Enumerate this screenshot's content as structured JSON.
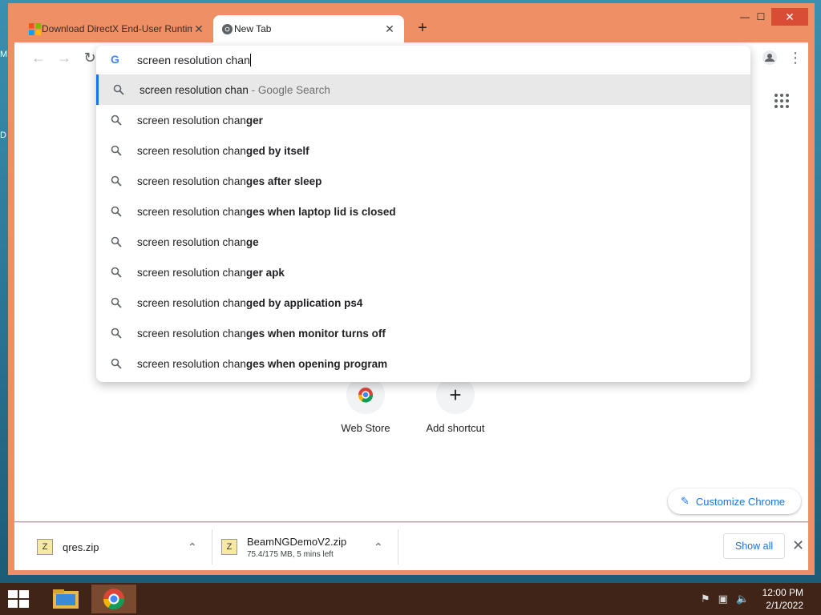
{
  "desktop": {
    "letters": [
      "M",
      "D"
    ]
  },
  "tabs": [
    {
      "title": "Download DirectX End-User Runtime",
      "close": "✕"
    },
    {
      "title": "New Tab",
      "close": "✕"
    }
  ],
  "new_tab_symbol": "+",
  "window_controls": {
    "minimize": "—",
    "maximize": "☐",
    "close": "✕"
  },
  "omnibox": {
    "input": "screen resolution chan",
    "google_glyph": "G",
    "suggestions": [
      {
        "typed": "screen resolution chan",
        "rest": "",
        "desc": " - Google Search",
        "selected": true
      },
      {
        "typed": "screen resolution chan",
        "rest": "ger"
      },
      {
        "typed": "screen resolution chan",
        "rest": "ged by itself"
      },
      {
        "typed": "screen resolution chan",
        "rest": "ges after sleep"
      },
      {
        "typed": "screen resolution chan",
        "rest": "ges when laptop lid is closed"
      },
      {
        "typed": "screen resolution chan",
        "rest": "ge"
      },
      {
        "typed": "screen resolution chan",
        "rest": "ger apk"
      },
      {
        "typed": "screen resolution chan",
        "rest": "ged by application ps4"
      },
      {
        "typed": "screen resolution chan",
        "rest": "ges when monitor turns off"
      },
      {
        "typed": "screen resolution chan",
        "rest": "ges when opening program"
      }
    ]
  },
  "shortcuts": [
    {
      "label": "Web Store"
    },
    {
      "label": "Add shortcut",
      "symbol": "+"
    }
  ],
  "customize_label": "Customize Chrome",
  "downloads": {
    "items": [
      {
        "name": "qres.zip",
        "status": ""
      },
      {
        "name": "BeamNGDemoV2.zip",
        "status": "75.4/175 MB, 5 mins left"
      }
    ],
    "show_all": "Show all",
    "close": "✕"
  },
  "taskbar": {
    "time": "12:00 PM",
    "date": "2/1/2022"
  },
  "colors": {
    "accent": "#1a73e8",
    "window_frame": "#ee8f66",
    "taskbar": "#3f2417"
  }
}
